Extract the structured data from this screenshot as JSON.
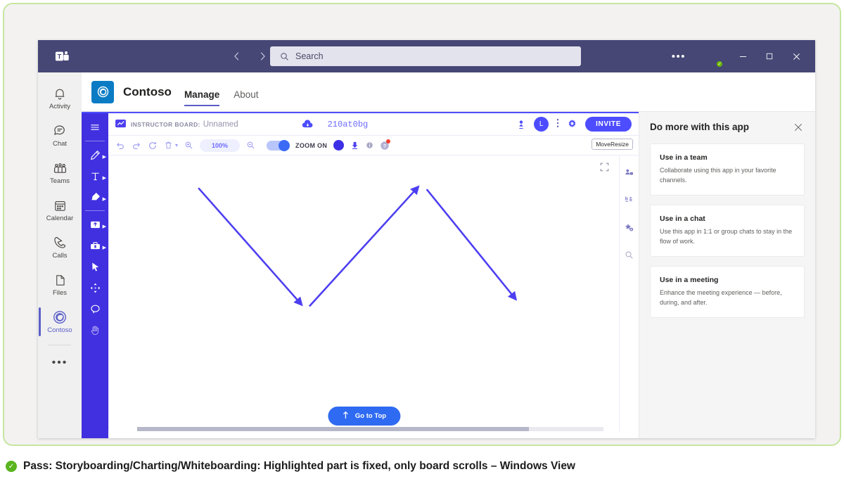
{
  "titlebar": {
    "logo_icon": "teams-logo-icon",
    "back_icon": "chevron-left-icon",
    "forward_icon": "chevron-right-icon",
    "search_placeholder": "Search",
    "search_value": "",
    "search_icon": "search-icon",
    "ellipsis": "•••",
    "minimize": "–",
    "maximize": "□",
    "close": "✕"
  },
  "app_rail": {
    "items": [
      {
        "label": "Activity",
        "icon": "bell-icon"
      },
      {
        "label": "Chat",
        "icon": "chat-bubble-icon"
      },
      {
        "label": "Teams",
        "icon": "teams-people-icon"
      },
      {
        "label": "Calendar",
        "icon": "calendar-icon"
      },
      {
        "label": "Calls",
        "icon": "phone-icon"
      },
      {
        "label": "Files",
        "icon": "file-icon"
      },
      {
        "label": "Contoso",
        "icon": "contoso-spiral-icon"
      }
    ],
    "more": "•••"
  },
  "app_header": {
    "app_icon": "contoso-app-icon",
    "title": "Contoso",
    "tabs": [
      {
        "label": "Manage",
        "active": true
      },
      {
        "label": "About",
        "active": false
      }
    ]
  },
  "board": {
    "header": {
      "board_icon": "board-icon",
      "label": "INSTRUCTOR BOARD:",
      "name": "Unnamed",
      "cloud_icon": "cloud-save-icon",
      "code": "210at0bg",
      "person_icon": "add-person-icon",
      "avatar_initial": "L",
      "menu_icon": "vertical-dots-icon",
      "settings_icon": "gear-icon",
      "invite_label": "INVITE"
    },
    "toolbar": {
      "undo_icon": "undo-icon",
      "redo_icon": "redo-icon",
      "refresh_icon": "refresh-icon",
      "delete_icon": "trash-icon",
      "delete_caret": "▾",
      "zoom_in_icon": "zoom-in-icon",
      "zoom_percent": "100%",
      "zoom_out_icon": "zoom-out-icon",
      "zoom_toggle_label": "ZOOM ON",
      "color_icon": "color-swatch-icon",
      "stamp_icon": "stamp-icon",
      "info_icon": "info-icon",
      "help_icon": "help-icon",
      "moveresize_label": "MoveResize"
    },
    "tools": [
      {
        "icon": "hamburger-menu-icon",
        "caret": false
      },
      {
        "icon": "pencil-icon",
        "caret": true
      },
      {
        "icon": "text-tool-icon",
        "caret": true
      },
      {
        "icon": "eraser-icon",
        "caret": true
      },
      {
        "icon": "upload-icon",
        "caret": true
      },
      {
        "icon": "toolbox-icon",
        "caret": true
      },
      {
        "icon": "pointer-icon",
        "caret": false
      },
      {
        "icon": "move-icon",
        "caret": false
      },
      {
        "icon": "lasso-icon",
        "caret": false
      },
      {
        "icon": "hand-pan-icon",
        "caret": false
      }
    ],
    "canvas": {
      "expand_icon": "fullscreen-icon",
      "goto_top_label": "Go to Top",
      "goto_top_icon": "arrow-up-icon",
      "stroke_color": "#4d3ff0"
    },
    "side_rail": [
      {
        "icon": "participants-icon"
      },
      {
        "icon": "align-icon"
      },
      {
        "icon": "add-favorite-icon"
      },
      {
        "icon": "search-board-icon"
      }
    ]
  },
  "side_panel": {
    "title": "Do more with this app",
    "close_icon": "close-icon",
    "cards": [
      {
        "title": "Use in a team",
        "desc": "Collaborate using this app in your favorite channels."
      },
      {
        "title": "Use in a chat",
        "desc": "Use this app in 1:1 or group chats to stay in the flow of work."
      },
      {
        "title": "Use in a meeting",
        "desc": "Enhance the meeting experience — before, during, and after."
      }
    ]
  },
  "caption": {
    "status_icon": "check-circle-icon",
    "text": "Pass: Storyboarding/Charting/Whiteboarding: Highlighted part is fixed, only board scrolls – Windows View"
  }
}
